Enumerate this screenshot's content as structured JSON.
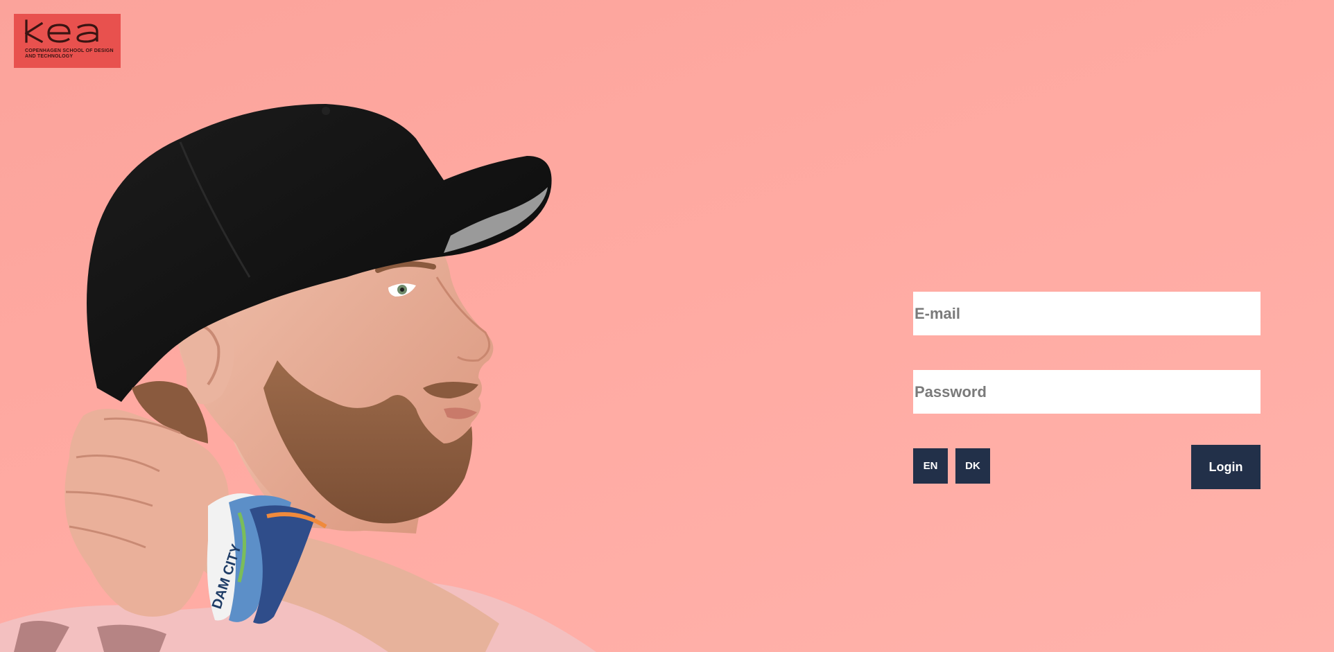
{
  "logo": {
    "wordmark": "kea",
    "subtitle_line1": "COPENHAGEN SCHOOL OF DESIGN",
    "subtitle_line2": "AND TECHNOLOGY"
  },
  "hero": {
    "wristband_text_1": "DAM CITY"
  },
  "form": {
    "email_placeholder": "E-mail",
    "password_placeholder": "Password",
    "lang_en": "EN",
    "lang_dk": "DK",
    "login_label": "Login"
  },
  "colors": {
    "background": "#ffaaa2",
    "logo_bg": "#e8514e",
    "button_bg": "#223049",
    "button_text": "#ffffff"
  }
}
